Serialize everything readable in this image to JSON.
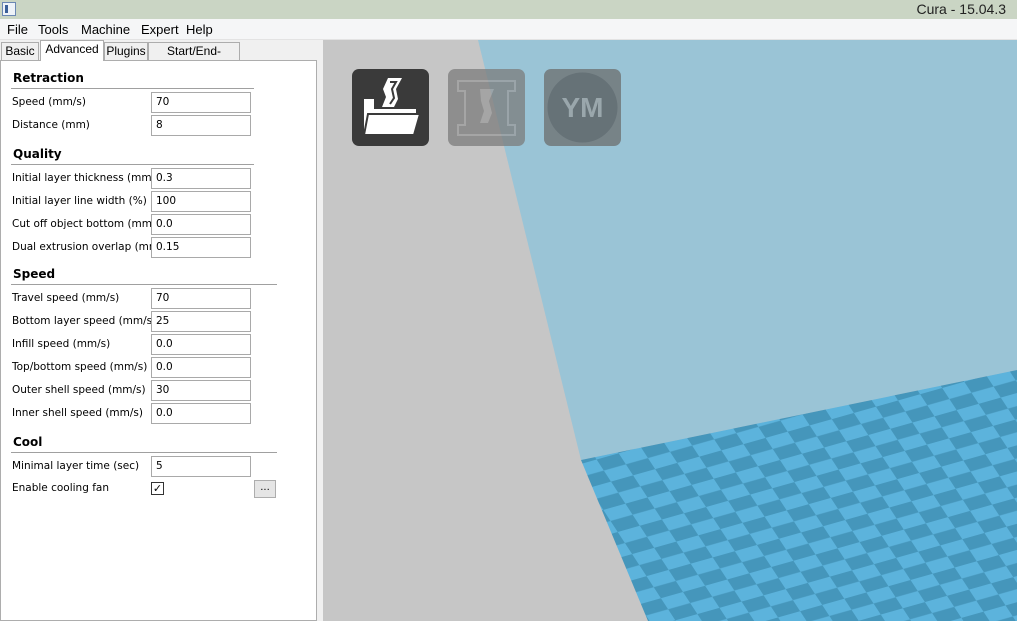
{
  "window": {
    "title": "Cura - 15.04.3"
  },
  "menu": [
    "File",
    "Tools",
    "Machine",
    "Expert",
    "Help"
  ],
  "tabs": [
    "Basic",
    "Advanced",
    "Plugins",
    "Start/End-GCode"
  ],
  "active_tab": "Advanced",
  "sections": {
    "retraction": {
      "title": "Retraction",
      "fields": [
        {
          "label": "Speed (mm/s)",
          "value": "70"
        },
        {
          "label": "Distance (mm)",
          "value": "8"
        }
      ]
    },
    "quality": {
      "title": "Quality",
      "fields": [
        {
          "label": "Initial layer thickness (mm)",
          "value": "0.3"
        },
        {
          "label": "Initial layer line width (%)",
          "value": "100"
        },
        {
          "label": "Cut off object bottom (mm)",
          "value": "0.0"
        },
        {
          "label": "Dual extrusion overlap (mm)",
          "value": "0.15"
        }
      ]
    },
    "speed": {
      "title": "Speed",
      "fields": [
        {
          "label": "Travel speed (mm/s)",
          "value": "70"
        },
        {
          "label": "Bottom layer speed (mm/s)",
          "value": "25"
        },
        {
          "label": "Infill speed (mm/s)",
          "value": "0.0"
        },
        {
          "label": "Top/bottom speed (mm/s)",
          "value": "0.0"
        },
        {
          "label": "Outer shell speed (mm/s)",
          "value": "30"
        },
        {
          "label": "Inner shell speed (mm/s)",
          "value": "0.0"
        }
      ]
    },
    "cool": {
      "title": "Cool",
      "fields": [
        {
          "label": "Minimal layer time (sec)",
          "value": "5"
        }
      ],
      "fan": {
        "label": "Enable cooling fan",
        "checked": true,
        "check_glyph": "✓",
        "more_button": "..."
      }
    }
  },
  "toolbar": {
    "load_icon": "load-model-icon",
    "print_icon": "print-icon",
    "ym_label": "YM"
  },
  "colors": {
    "viewport_bg": "#c6c6c6",
    "build_volume": "#9ac4d6",
    "bed_light": "#5cb3dc",
    "bed_dark": "#4596bb"
  }
}
